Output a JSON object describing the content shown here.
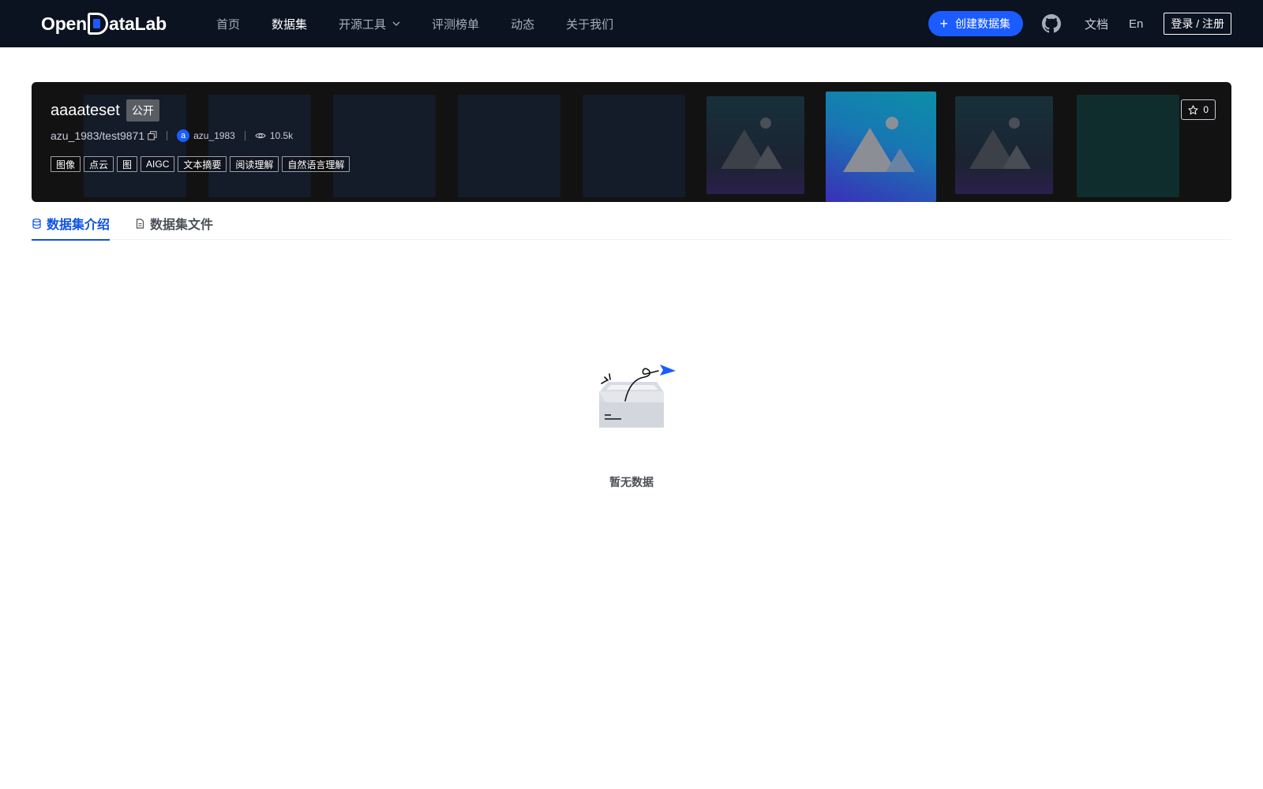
{
  "brand": {
    "logo_prefix": "Open",
    "logo_suffix": "ataLab"
  },
  "nav": {
    "items": [
      {
        "label": "首页"
      },
      {
        "label": "数据集"
      },
      {
        "label": "开源工具"
      },
      {
        "label": "评测榜单"
      },
      {
        "label": "动态"
      },
      {
        "label": "关于我们"
      }
    ],
    "active_index": 1
  },
  "header_actions": {
    "create_label": "创建数据集",
    "docs_label": "文档",
    "lang_label": "En",
    "login_label": "登录 / 注册"
  },
  "dataset": {
    "title": "aaaateset",
    "visibility": "公开",
    "path": "azu_1983/test9871",
    "owner_initial": "a",
    "owner": "azu_1983",
    "views": "10.5k",
    "stars": "0",
    "tags": [
      "图像",
      "点云",
      "图",
      "AIGC",
      "文本摘要",
      "阅读理解",
      "自然语言理解"
    ]
  },
  "tabs": [
    {
      "label": "数据集介绍"
    },
    {
      "label": "数据集文件"
    }
  ],
  "empty": {
    "text": "暂无数据"
  },
  "colors": {
    "nav_bg": "#0b1220",
    "accent": "#1a5cff",
    "tab_active": "#0d53de"
  }
}
